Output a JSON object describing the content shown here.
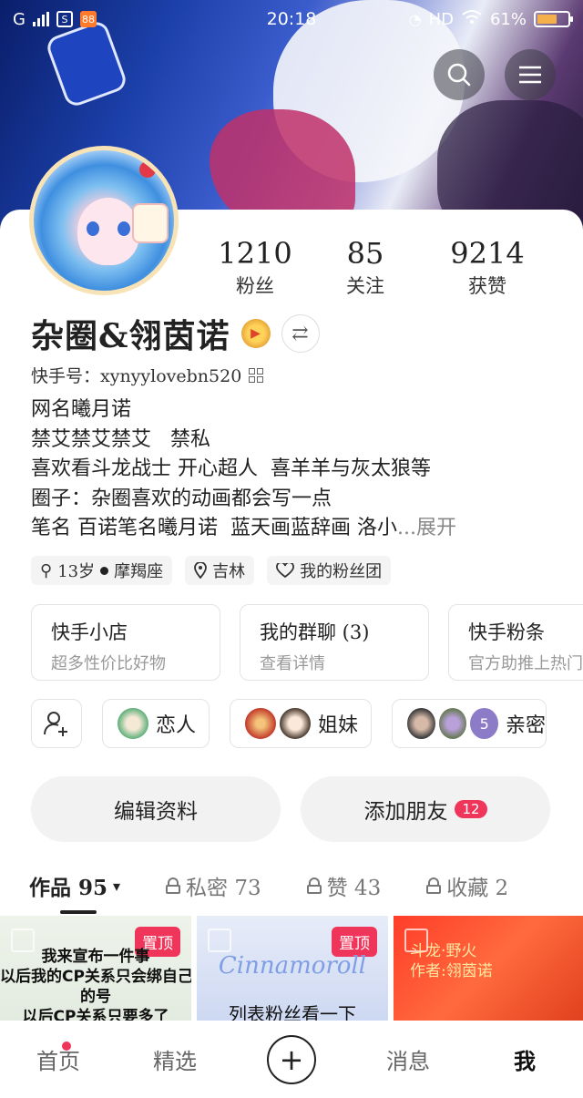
{
  "status_bar": {
    "network": "G",
    "time": "20:18",
    "hd": "HD",
    "battery": "61%",
    "battery_level": 0.61
  },
  "profile": {
    "stats": [
      {
        "value": "1210",
        "label": "粉丝"
      },
      {
        "value": "85",
        "label": "关注"
      },
      {
        "value": "9214",
        "label": "获赞"
      }
    ],
    "name": "杂圈&翎茵诺",
    "kuaishou_id": "快手号：xynyylovebn520",
    "bio": [
      "网名曦月诺",
      "禁艾禁艾禁艾   禁私",
      "喜欢看斗龙战士 开心超人  喜羊羊与灰太狼等",
      "圈子：杂圈喜欢的动画都会写一点"
    ],
    "bio_last": "笔名 百诺笔名曦月诺  蓝天画蓝辞画 洛小",
    "bio_more": "...",
    "bio_expand": "展开",
    "tags": [
      "13岁",
      "摩羯座",
      "吉林",
      "我的粉丝团"
    ]
  },
  "feature_cards": [
    {
      "title": "快手小店",
      "subtitle": "超多性价比好物"
    },
    {
      "title": "我的群聊 (3)",
      "subtitle": "查看详情"
    },
    {
      "title": "快手粉条",
      "subtitle": "官方助推上热门"
    }
  ],
  "relations": [
    {
      "label": "恋人"
    },
    {
      "label": "姐妹"
    },
    {
      "label": "亲密",
      "extra_count": "5"
    }
  ],
  "actions": {
    "edit_profile": "编辑资料",
    "add_friend": "添加朋友",
    "add_friend_count": "12"
  },
  "tabs": [
    {
      "label": "作品 95",
      "caret": "▾",
      "locked": false
    },
    {
      "label": "私密 73",
      "locked": true
    },
    {
      "label": "赞 43",
      "locked": true
    },
    {
      "label": "收藏 2",
      "locked": true
    }
  ],
  "posts": [
    {
      "pinned": "置顶",
      "caption": "我来宣布一件事\n以后我的CP关系只会绑自己\n的号\n以后CP关系只要多了"
    },
    {
      "pinned": "置顶",
      "logo": "Cinnamoroll",
      "caption": "列表粉丝看一下"
    },
    {
      "caption": "斗龙·野火\n作者:翎茵诺"
    }
  ],
  "bottom_nav": [
    "首页",
    "精选",
    "+",
    "消息",
    "我"
  ],
  "colors": {
    "accent": "#f0355a",
    "banner": "#1b3fa8"
  }
}
